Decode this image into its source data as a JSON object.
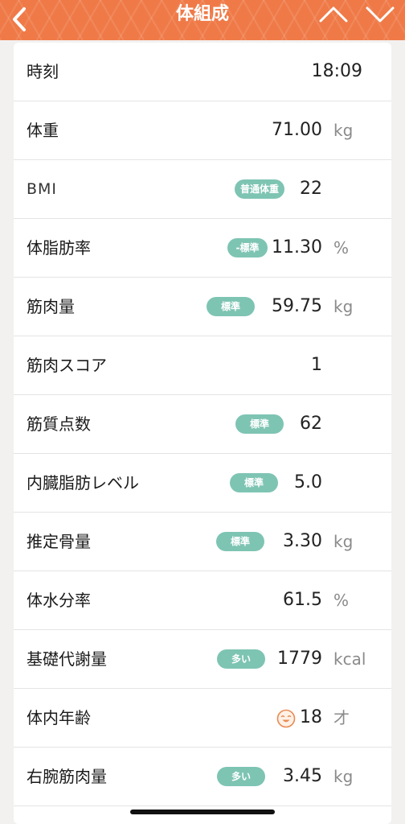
{
  "header": {
    "title": "体組成",
    "back_icon": "chevron-left-icon",
    "prev_icon": "chevron-up-icon",
    "next_icon": "chevron-down-icon",
    "background_color": "#ef7a48"
  },
  "badge_color": "#7ec4b3",
  "rows": [
    {
      "label": "時刻",
      "value": "18:09",
      "unit": "",
      "badge": ""
    },
    {
      "label": "体重",
      "value": "71.00",
      "unit": "kg",
      "badge": ""
    },
    {
      "label": "BMI",
      "value": "22",
      "unit": "",
      "badge": "普通体重"
    },
    {
      "label": "体脂肪率",
      "value": "11.30",
      "unit": "%",
      "badge": "-標準"
    },
    {
      "label": "筋肉量",
      "value": "59.75",
      "unit": "kg",
      "badge": "標準"
    },
    {
      "label": "筋肉スコア",
      "value": "1",
      "unit": "",
      "badge": ""
    },
    {
      "label": "筋質点数",
      "value": "62",
      "unit": "",
      "badge": "標準"
    },
    {
      "label": "内臓脂肪レベル",
      "value": "5.0",
      "unit": "",
      "badge": "標準"
    },
    {
      "label": "推定骨量",
      "value": "3.30",
      "unit": "kg",
      "badge": "標準"
    },
    {
      "label": "体水分率",
      "value": "61.5",
      "unit": "%",
      "badge": ""
    },
    {
      "label": "基礎代謝量",
      "value": "1779",
      "unit": "kcal",
      "badge": "多い"
    },
    {
      "label": "体内年齢",
      "value": "18",
      "unit": "才",
      "badge": "",
      "icon": "smiley-face-icon"
    },
    {
      "label": "右腕筋肉量",
      "value": "3.45",
      "unit": "kg",
      "badge": "多い"
    }
  ]
}
